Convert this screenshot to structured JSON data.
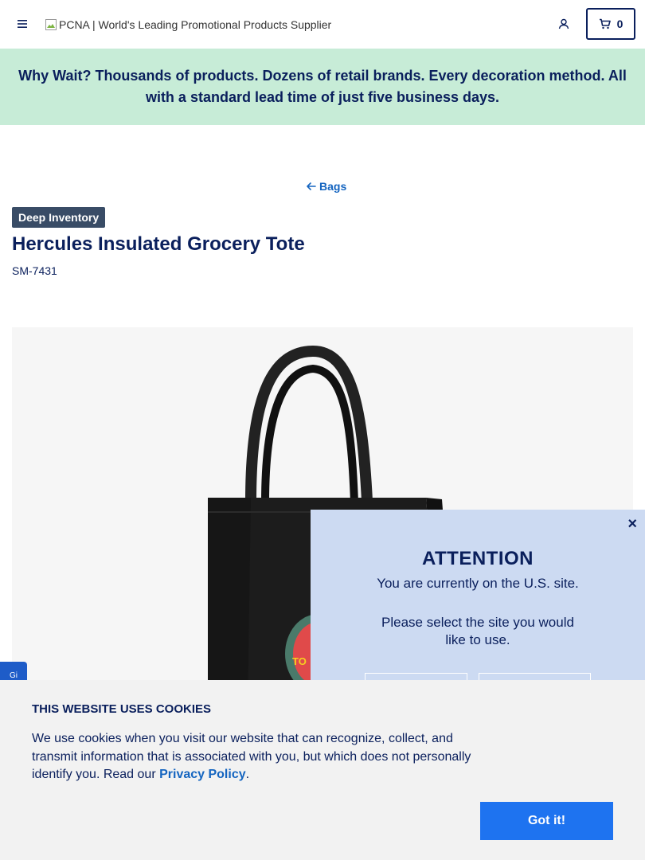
{
  "header": {
    "logo_alt": "PCNA | World's Leading Promotional Products Supplier",
    "cart_count": "0"
  },
  "promo": {
    "text": "Why Wait? Thousands of products. Dozens of retail brands. Every decoration method. All with a standard lead time of just five business days."
  },
  "breadcrumb": {
    "back_label": "Bags"
  },
  "product": {
    "badge": "Deep Inventory",
    "title": "Hercules Insulated Grocery Tote",
    "sku": "SM-7431",
    "bag_color": "#1a1a1a"
  },
  "feedback_tab": {
    "label": "Gi"
  },
  "attention_modal": {
    "close": "×",
    "title": "ATTENTION",
    "line1": "You are currently on the U.S. site.",
    "line2": "Please select the site you would like to use."
  },
  "cookie_banner": {
    "title": "THIS WEBSITE USES COOKIES",
    "text_before": "We use cookies when you visit our website that can recognize, collect, and transmit information that is associated with you, but which does not personally identify you. Read our ",
    "link": "Privacy Policy",
    "text_after": ".",
    "button": "Got it!"
  },
  "colors": {
    "navy": "#0a1f5c",
    "promo_bg": "#c7ecd7",
    "accent_blue": "#1e73f0",
    "modal_bg": "#ccdaf2",
    "badge_bg": "#394c66"
  }
}
